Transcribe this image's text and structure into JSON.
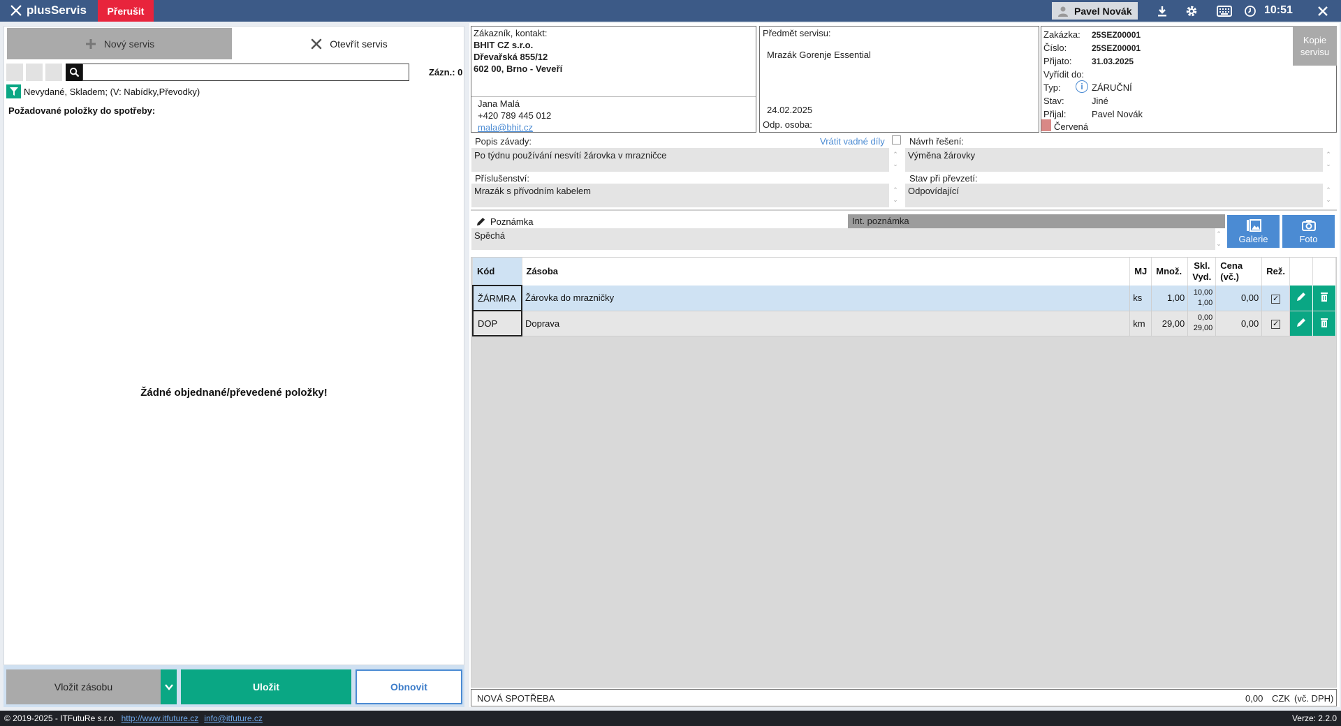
{
  "app": {
    "name": "plusServis",
    "prerusit": "Přerušit",
    "user": "Pavel Novák",
    "time": "10:51"
  },
  "left": {
    "tab_new": "Nový servis",
    "tab_open": "Otevřít servis",
    "search_value": "",
    "count": "Zázn.: 0",
    "filter": "Nevydané, Skladem; (V: Nabídky,Převodky)",
    "required_label": "Požadované položky do spotřeby:",
    "empty_message": "Žádné objednané/převedené položky!",
    "btn_insert": "Vložit zásobu",
    "btn_save": "Uložit",
    "btn_refresh": "Obnovit"
  },
  "customer": {
    "label": "Zákazník, kontakt:",
    "company": "BHIT CZ s.r.o.",
    "street": "Dřevařská 855/12",
    "city": "602 00, Brno - Veveří",
    "contact_name": "Jana Malá",
    "phone": "+420 789 445 012",
    "email": "mala@bhit.cz"
  },
  "subject": {
    "label": "Předmět servisu:",
    "value": "Mrazák Gorenje Essential",
    "date": "24.02.2025",
    "responsible_label": "Odp. osoba:"
  },
  "order": {
    "zakazka_label": "Zakázka:",
    "zakazka": "25SEZ00001",
    "cislo_label": "Číslo:",
    "cislo": "25SEZ00001",
    "prijato_label": "Přijato:",
    "prijato": "31.03.2025",
    "vyridit_label": "Vyřídit do:",
    "typ_label": "Typ:",
    "typ": "ZÁRUČNÍ",
    "stav_label": "Stav:",
    "stav": "Jiné",
    "prijal_label": "Přijal:",
    "prijal": "Pavel Novák",
    "color_label": "Červená",
    "color_hex": "#d98886",
    "kopie": "Kopie servisu"
  },
  "details": {
    "popis_label": "Popis závady:",
    "popis": "Po týdnu používání nesvítí žárovka v mrazničce",
    "vratit_label": "Vrátit vadné díly",
    "navrh_label": "Návrh řešení:",
    "navrh": "Výměna žárovky",
    "prislusenstvi_label": "Příslušenství:",
    "prislusenstvi": "Mrazák s přívodním kabelem",
    "stav_label": "Stav při převzetí:",
    "stav": "Odpovídající",
    "poznamka_label": "Poznámka",
    "poznamka": "Spěchá",
    "int_poznamka_label": "Int. poznámka",
    "galerie": "Galerie",
    "foto": "Foto"
  },
  "table": {
    "headers": {
      "kod": "Kód",
      "zasoba": "Zásoba",
      "mj": "MJ",
      "mnoz": "Množ.",
      "skl1": "Skl.",
      "skl2": "Vyd.",
      "cena1": "Cena",
      "cena2": "(vč.)",
      "rez": "Rež."
    },
    "rows": [
      {
        "kod": "ŽÁRMRA",
        "zasoba": "Žárovka do mrazničky",
        "mj": "ks",
        "mnoz": "1,00",
        "skl": "10,00",
        "vyd": "1,00",
        "cena": "0,00",
        "rez": "☑"
      },
      {
        "kod": "DOP",
        "zasoba": "Doprava",
        "mj": "km",
        "mnoz": "29,00",
        "skl": "0,00",
        "vyd": "29,00",
        "cena": "0,00",
        "rez": "☑"
      }
    ]
  },
  "total": {
    "label": "NOVÁ SPOTŘEBA",
    "amount": "0,00",
    "currency": "CZK",
    "vat": "(vč. DPH)"
  },
  "footer": {
    "copyright": "© 2019-2025 - ITFutuRe s.r.o.",
    "website": "http://www.itfuture.cz",
    "email": "info@itfuture.cz",
    "version": "Verze: 2.2.0"
  },
  "colors": {
    "topbar": "#3c5a87",
    "accent_green": "#0aa784",
    "accent_red": "#e8243c",
    "accent_blue": "#4b8bd3"
  }
}
